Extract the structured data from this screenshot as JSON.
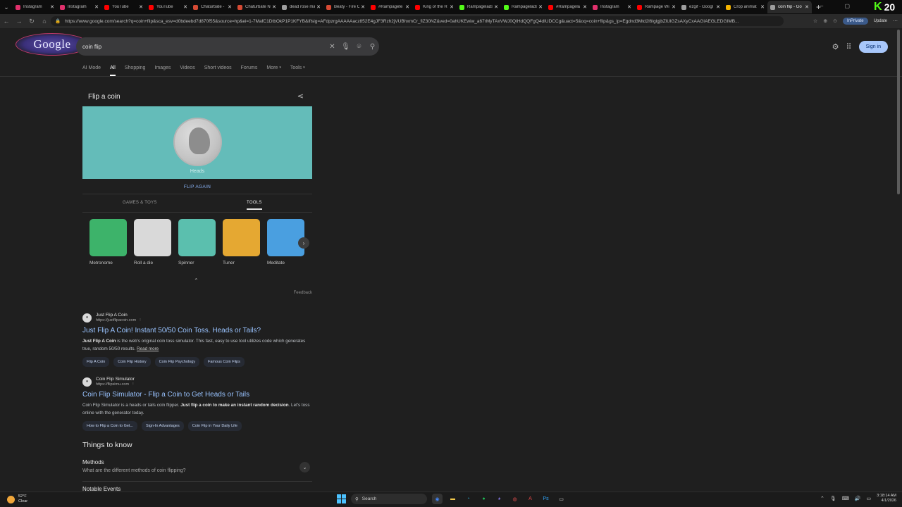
{
  "browser": {
    "tabs": [
      {
        "title": "Instagram",
        "color": "#e1306c",
        "active": false
      },
      {
        "title": "Instagram",
        "color": "#e1306c",
        "active": false
      },
      {
        "title": "YouTube",
        "color": "#ff0000",
        "active": false
      },
      {
        "title": "YouTube",
        "color": "#ff0000",
        "active": false
      },
      {
        "title": "Chaturbate -",
        "color": "#d64a34",
        "active": false
      },
      {
        "title": "Chaturbate Ne",
        "color": "#d64a34",
        "active": false
      },
      {
        "title": "dead rose ma",
        "color": "#9e9e9e",
        "active": false
      },
      {
        "title": "Beaty - Fire C",
        "color": "#d64a34",
        "active": false
      },
      {
        "title": "#Rampagete",
        "color": "#ff0000",
        "active": false
      },
      {
        "title": "King of the R",
        "color": "#ff0000",
        "active": false
      },
      {
        "title": "Rampagelads",
        "color": "#53fc18",
        "active": false
      },
      {
        "title": "Rampagelads",
        "color": "#53fc18",
        "active": false
      },
      {
        "title": "#Rampagela",
        "color": "#ff0000",
        "active": false
      },
      {
        "title": "Instagram",
        "color": "#e1306c",
        "active": false
      },
      {
        "title": "Rampage Wi",
        "color": "#ff0000",
        "active": false
      },
      {
        "title": "ezgif - Googl",
        "color": "#9e9e9e",
        "active": false
      },
      {
        "title": "Crop animat",
        "color": "#f4b400",
        "active": false
      },
      {
        "title": "coin flip - Go",
        "color": "#9e9e9e",
        "active": true
      }
    ],
    "url": "https://www.google.com/search?q=coin+flip&sca_esv=d0bdeebd7d870f55&source=hp&ei=1-7MafC1DtbOkP1P1KFYB&iflsig=AFdpzrgAAAAAacz852E4gJF3Rzh2jVUBhxmCr_fiZ30NZ&ved=0ahUKEwiw_a67rMyTAxVWJ0QIHdQQFgQ4dIUDCCg&uact=5&oq=coin+flip&gs_lp=Egdnd3Mtd2l6IglgjbZlUlGZsAXyCxAAGIAEGLEDGIMB...",
    "inprivate_label": "InPrivate",
    "update_label": "Update",
    "brand_badge": "20"
  },
  "google": {
    "logo_text": "Google",
    "query": "coin flip",
    "signin_label": "Sign in",
    "filters": [
      "AI Mode",
      "All",
      "Shopping",
      "Images",
      "Videos",
      "Short videos",
      "Forums",
      "More",
      "Tools"
    ],
    "active_filter": "All"
  },
  "coin_card": {
    "title": "Flip a coin",
    "coin_label": "Heads",
    "flip_again": "FLIP AGAIN",
    "category_tabs": [
      "GAMES & TOYS",
      "TOOLS"
    ],
    "active_category": "TOOLS",
    "tools": [
      {
        "label": "Metronome",
        "color": "#3db36a"
      },
      {
        "label": "Roll a die",
        "color": "#d9d9d9"
      },
      {
        "label": "Spinner",
        "color": "#5bbfae"
      },
      {
        "label": "Tuner",
        "color": "#e5a832"
      },
      {
        "label": "Meditate",
        "color": "#4a9fe0"
      }
    ],
    "feedback": "Feedback"
  },
  "results": [
    {
      "site_name": "Just Flip A Coin",
      "site_url": "https://justflipacoin.com",
      "title": "Just Flip A Coin! Instant 50/50 Coin Toss. Heads or Tails?",
      "snippet_bold": "Just Flip A Coin",
      "snippet": " is the web's original coin toss simulator. This fast, easy to use tool utilizes code which generates true, random 50/50 results.",
      "read_more": "Read more",
      "chips": [
        "Flip A Coin",
        "Coin Flip History",
        "Coin Flip Psychology",
        "Famous Coin Flips"
      ]
    },
    {
      "site_name": "Coin Flip Simulator",
      "site_url": "https://flipsimu.com",
      "title": "Coin Flip Simulator - Flip a Coin to Get Heads or Tails",
      "snippet_pre": "Coin Flip Simulator is a heads or tails coin flipper. ",
      "snippet_bold": "Just flip a coin to make an instant random decision",
      "snippet_post": ". Let's toss online with the generator today.",
      "chips": [
        "How to Flip a Coin to Get...",
        "Sign-In Advantages",
        "Coin Flip in Your Daily Life"
      ]
    }
  ],
  "things_to_know": {
    "title": "Things to know",
    "items": [
      {
        "heading": "Methods",
        "question": "What are the different methods of coin flipping?"
      },
      {
        "heading": "Notable Events"
      }
    ]
  },
  "taskbar": {
    "temperature": "52°F",
    "condition": "Clear",
    "search_label": "Search",
    "time": "3:18:14 AM",
    "date": "4/1/2026"
  }
}
